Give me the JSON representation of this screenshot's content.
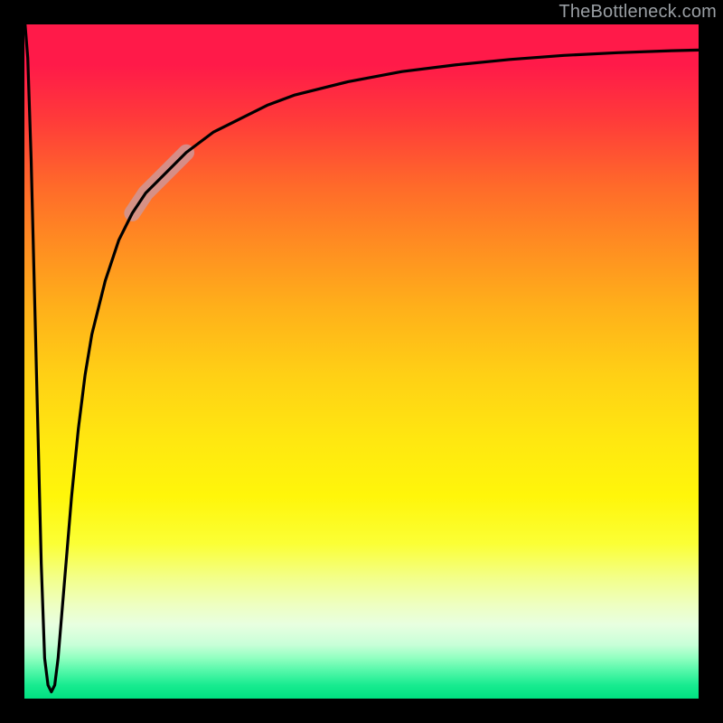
{
  "watermark": "TheBottleneck.com",
  "chart_data": {
    "type": "line",
    "title": "",
    "xlabel": "",
    "ylabel": "",
    "xlim": [
      0,
      100
    ],
    "ylim": [
      0,
      100
    ],
    "grid": false,
    "legend": false,
    "annotations": [],
    "series": [
      {
        "name": "bottleneck-curve",
        "color": "#000000",
        "x": [
          0.1,
          0.5,
          1.0,
          1.5,
          2.0,
          2.5,
          3.0,
          3.5,
          4.0,
          4.5,
          5.0,
          5.5,
          6.0,
          7.0,
          8.0,
          9.0,
          10.0,
          12.0,
          14.0,
          16.0,
          18.0,
          20.0,
          24.0,
          28.0,
          32.0,
          36.0,
          40.0,
          48.0,
          56.0,
          64.0,
          72.0,
          80.0,
          88.0,
          96.0,
          100.0
        ],
        "y": [
          100,
          95,
          80,
          60,
          40,
          20,
          6,
          2,
          1,
          2,
          6,
          12,
          18,
          30,
          40,
          48,
          54,
          62,
          68,
          72,
          75,
          77,
          81,
          84,
          86,
          88,
          89.5,
          91.5,
          93,
          94,
          94.8,
          95.4,
          95.8,
          96.1,
          96.2
        ]
      },
      {
        "name": "highlight-segment",
        "color": "#cf9797",
        "x_range": [
          16,
          24
        ],
        "note": "thicker semi-transparent overlay on the curve between roughly x=16 and x=24"
      }
    ],
    "background_gradient": {
      "top": "#ff1a49",
      "middle": "#ffe810",
      "bottom": "#00e080"
    }
  }
}
